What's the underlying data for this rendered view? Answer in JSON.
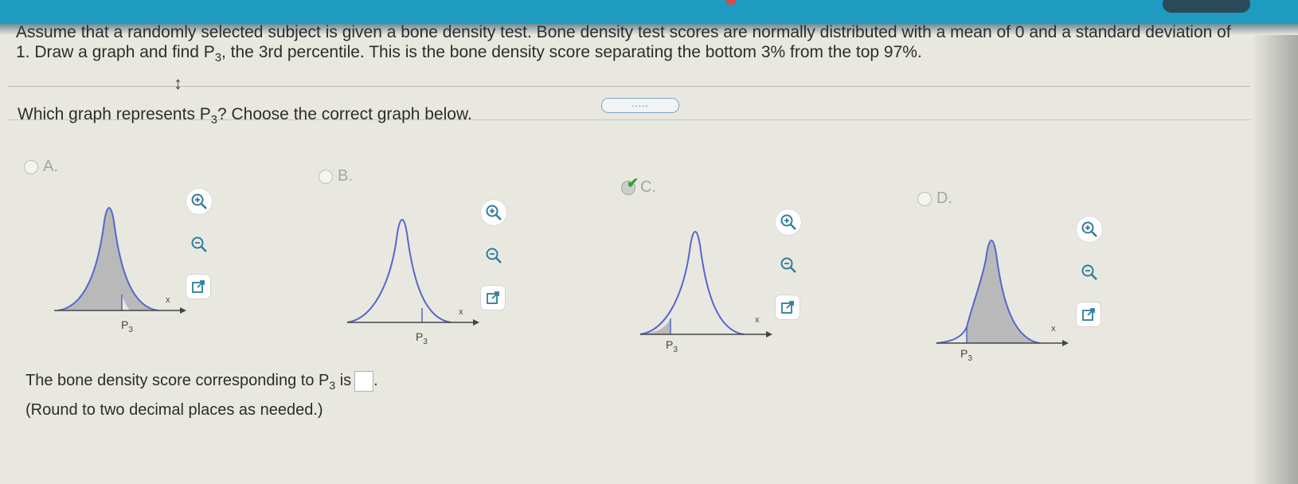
{
  "prompt": {
    "line1": "Assume that a randomly selected subject is given a bone density test. Bone density test scores are normally distributed with a mean of 0 and a standard deviation of",
    "line2a": "1. Draw a graph and find P",
    "line2_sub": "3",
    "line2b": ", the 3rd percentile. This is the bone density score separating the bottom 3% from the top 97%."
  },
  "more_button": ".....",
  "question": {
    "text_a": "Which graph represents P",
    "sub": "3",
    "text_b": "? Choose the correct graph below."
  },
  "options": [
    {
      "label": "A.",
      "selected": false,
      "p_label": "P",
      "p_sub": "3",
      "axis_label": "x",
      "shading": "left of P3 large (most of curve)"
    },
    {
      "label": "B.",
      "selected": false,
      "p_label": "P",
      "p_sub": "3",
      "axis_label": "x",
      "shading": "none"
    },
    {
      "label": "C.",
      "selected": true,
      "p_label": "P",
      "p_sub": "3",
      "axis_label": "x",
      "shading": "left tail small"
    },
    {
      "label": "D.",
      "selected": false,
      "p_label": "P",
      "p_sub": "3",
      "axis_label": "x",
      "shading": "right of P3 large"
    }
  ],
  "answer": {
    "text_a": "The bone density score corresponding to P",
    "sub": "3",
    "text_b": " is",
    "text_end": ".",
    "note": "(Round to two decimal places as needed.)"
  },
  "icons": [
    "zoom-in-icon",
    "zoom-out-icon",
    "external-link-icon",
    "resize-vertical-icon"
  ],
  "colors": {
    "topbar": "#1f9ac0",
    "curve": "#5566cc",
    "shade": "#b9b9b9",
    "check": "#3e9a3e"
  }
}
